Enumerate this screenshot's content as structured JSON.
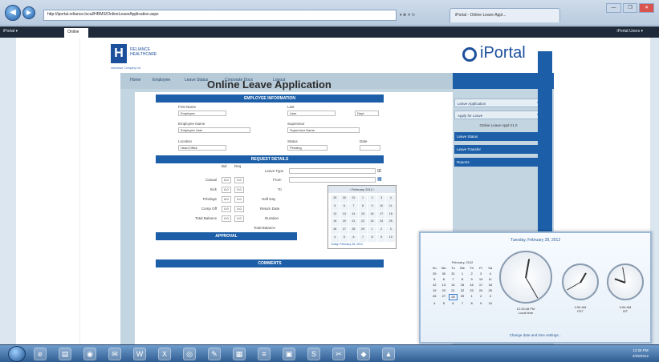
{
  "browser": {
    "address_url": "http://iportal.reliance.local/HRMS/OnlineLeaveApplication.aspx",
    "tab_label": "iPortal - Online Leave Appl...",
    "addr_tools": "▾ ⊗ ✕ ↻",
    "window_controls": [
      "—",
      "❐",
      "✕"
    ]
  },
  "app_bar": {
    "left_item": "iPortal ▾",
    "active_tab": "Online",
    "right_item": "iPortal Users ▾"
  },
  "header": {
    "logo_letter": "H",
    "logo_text": "RELIANCE",
    "logo_text2": "HEALTHCARE",
    "logo_subtitle": "Insurance Company Ltd",
    "portal_name": "iPortal"
  },
  "nav": {
    "items": [
      "Home",
      "Employee",
      "Leave Status",
      "Corporate Docs",
      "Logout"
    ]
  },
  "side_panel": {
    "items": [
      {
        "label": "Leave Application",
        "style": "light"
      },
      {
        "label": "Apply for Leave",
        "style": "light"
      },
      {
        "label": "Online Leave Appl.V1.0",
        "style": "plain"
      },
      {
        "label": "Leave Status",
        "style": "dark"
      },
      {
        "label": "Leave Transfer",
        "style": "dark"
      },
      {
        "label": "Reports",
        "style": "dark"
      }
    ]
  },
  "form": {
    "title": "Online Leave Application",
    "section_employee": "EMPLOYEE INFORMATION",
    "section_request": "REQUEST DETAILS",
    "section_approval": "APPROVAL",
    "section_comments": "COMMENTS",
    "fields": {
      "first_name_label": "First Name",
      "first_name_value": "Employee",
      "last_name_label": "Last",
      "last_name_value": "User",
      "dept_label": "Dept",
      "employee_name_label": "Employee Name",
      "employee_name_value": "Employee User",
      "supervisor_label": "Supervisor",
      "supervisor_value": "Supervisor Name",
      "location_label": "Location",
      "location_value": "Head Office",
      "status_label": "Status",
      "status_value": "Pending",
      "date_label": "Date"
    },
    "leave_table": {
      "col_headers": [
        "Bal",
        "Req"
      ],
      "rows": [
        {
          "label": "Casual",
          "bal": "6.0",
          "req": "0.0"
        },
        {
          "label": "Sick",
          "bal": "6.0",
          "req": "0.0"
        },
        {
          "label": "Privilege",
          "bal": "8.0",
          "req": "0.0"
        },
        {
          "label": "Comp Off",
          "bal": "0.0",
          "req": "0.0"
        },
        {
          "label": "Total Balance",
          "bal": "0.0",
          "req": "0.0"
        }
      ],
      "leave_type_label": "Leave Type",
      "from_label": "From",
      "to_label": "To",
      "half_day_label": "Half Day",
      "return_date_label": "Return Date",
      "duration_label": "Duration",
      "total_balance_label": "Total Balance"
    },
    "calendar_popup": {
      "header": "‹  February 2012  ›",
      "days": [
        "29",
        "30",
        "31",
        "1",
        "2",
        "3",
        "4",
        "5",
        "6",
        "7",
        "8",
        "9",
        "10",
        "11",
        "12",
        "13",
        "14",
        "15",
        "16",
        "17",
        "18",
        "19",
        "20",
        "21",
        "22",
        "23",
        "24",
        "25",
        "26",
        "27",
        "28",
        "29",
        "1",
        "2",
        "3",
        "4",
        "5",
        "6",
        "7",
        "8",
        "9",
        "10"
      ],
      "footer": "Today: February 28, 2012"
    }
  },
  "clock_flyout": {
    "date": "Tuesday, February 28, 2012",
    "calendar_header": "February, 2012",
    "weekdays": [
      "Su",
      "Mo",
      "Tu",
      "We",
      "Th",
      "Fr",
      "Sa"
    ],
    "days": [
      "29",
      "30",
      "31",
      "1",
      "2",
      "3",
      "4",
      "5",
      "6",
      "7",
      "8",
      "9",
      "10",
      "11",
      "12",
      "13",
      "14",
      "15",
      "16",
      "17",
      "18",
      "19",
      "20",
      "21",
      "22",
      "23",
      "24",
      "25",
      "26",
      "27",
      "28",
      "29",
      "1",
      "2",
      "3",
      "4",
      "5",
      "6",
      "7",
      "8",
      "9",
      "10"
    ],
    "today_index": 30,
    "clocks": [
      {
        "time": "12:26:48 PM",
        "label": "Local time"
      },
      {
        "time": "2:56 AM",
        "label": "PST"
      },
      {
        "time": "9:56 AM",
        "label": "IST"
      }
    ],
    "link": "Change date and time settings..."
  },
  "taskbar": {
    "icons": [
      "ie-icon",
      "folder-icon",
      "media-icon",
      "outlook-icon",
      "word-icon",
      "excel-icon",
      "chrome-icon",
      "paint-icon",
      "calc-icon",
      "notepad-icon",
      "explorer-icon",
      "skype-icon",
      "snip-icon",
      "misc-icon",
      "network-icon"
    ],
    "time": "12:26 PM",
    "date": "2/28/2012"
  }
}
